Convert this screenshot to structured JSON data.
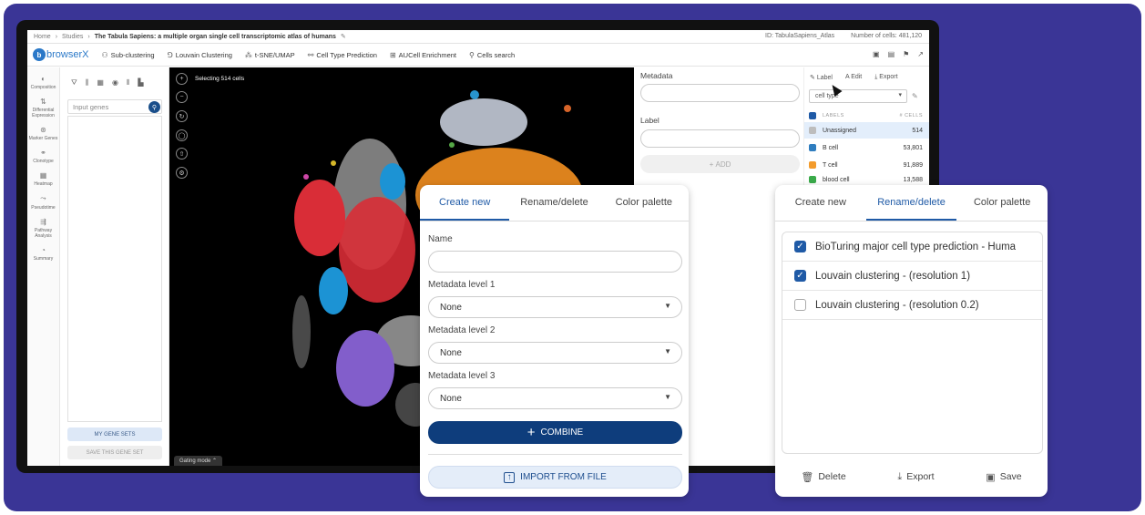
{
  "breadcrumb": {
    "home": "Home",
    "studies": "Studies",
    "study_title": "The Tabula Sapiens: a multiple organ single cell transcriptomic atlas of humans",
    "id_text": "ID: TabulaSapiens_Atlas",
    "cells_text": "Number of cells: 481,120"
  },
  "toolbar": {
    "logo_text": "browserX",
    "items": [
      "Sub-clustering",
      "Louvain Clustering",
      "t-SNE/UMAP",
      "Cell Type Prediction",
      "AUCell Enrichment",
      "Cells search"
    ]
  },
  "leftnav": [
    "Composition",
    "Differential Expression",
    "Marker Genes",
    "Clonotype",
    "Heatmap",
    "Pseudotime",
    "Pathway Analysis",
    "Summary"
  ],
  "genes": {
    "placeholder": "Input genes",
    "my_gene_sets": "MY GENE SETS",
    "save_gene_set": "SAVE THIS GENE SET"
  },
  "canvas": {
    "selecting": "Selecting 514 cells",
    "gating": "Gating mode"
  },
  "metadata_card": {
    "metadata_label": "Metadata",
    "label_label": "Label",
    "add": "ADD"
  },
  "legend": {
    "tabs": [
      "Label",
      "Edit",
      "Export"
    ],
    "select_value": "cell type",
    "head_labels": "LABELS",
    "head_cells": "# CELLS",
    "rows": [
      {
        "label": "Unassigned",
        "count": "514",
        "color": "#bdbdbd"
      },
      {
        "label": "B cell",
        "count": "53,801",
        "color": "#2f7dbf"
      },
      {
        "label": "T cell",
        "count": "91,889",
        "color": "#f39b2c"
      },
      {
        "label": "blood cell",
        "count": "13,588",
        "color": "#3aaa4a"
      }
    ]
  },
  "create_card": {
    "tabs": [
      "Create new",
      "Rename/delete",
      "Color palette"
    ],
    "name_label": "Name",
    "level1_label": "Metadata level 1",
    "level2_label": "Metadata level 2",
    "level3_label": "Metadata level 3",
    "level1_value": "None",
    "level2_value": "None",
    "level3_value": "None",
    "combine": "COMBINE",
    "import": "IMPORT FROM FILE"
  },
  "rename_card": {
    "tabs": [
      "Create new",
      "Rename/delete",
      "Color palette"
    ],
    "items": [
      {
        "label": "BioTuring major cell type prediction - Huma",
        "checked": true
      },
      {
        "label": "Louvain clustering - (resolution 1)",
        "checked": true
      },
      {
        "label": "Louvain clustering - (resolution 0.2)",
        "checked": false
      }
    ],
    "delete": "Delete",
    "export": "Export",
    "save": "Save"
  },
  "colors": {
    "frame": "#3a3596",
    "primary": "#0e3d7c",
    "accent": "#1f5aa6"
  }
}
